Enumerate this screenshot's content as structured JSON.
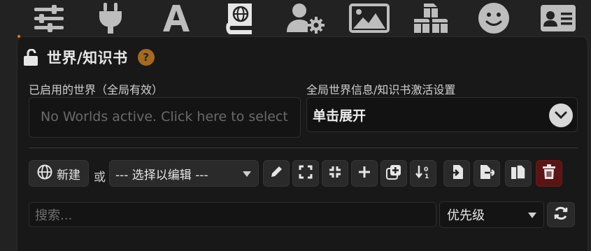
{
  "topbar": {
    "icons": [
      "sliders-icon",
      "plug-icon",
      "font-a-icon",
      "world-book-icon",
      "user-gear-icon",
      "image-landscape-icon",
      "cubes-icon",
      "smiley-icon",
      "id-card-icon"
    ],
    "active": "world-book-icon",
    "icon_color": "#bdbdbd"
  },
  "panel": {
    "title": "世界/知识书",
    "help_glyph": "?",
    "accent": "#a66a1e"
  },
  "active_worlds": {
    "label": "已启用的世界（全局有效）",
    "placeholder": "No Worlds active. Click here to select"
  },
  "global_settings": {
    "label": "全局世界信息/知识书激活设置",
    "expander_text": "单击展开"
  },
  "toolbar": {
    "new_label": "新建",
    "or_label": "或",
    "select_placeholder": "--- 选择以编辑 ---",
    "icons": [
      "pencil-icon",
      "expand-icon",
      "compress-icon",
      "plus-icon",
      "duplicate-plus-icon",
      "sort-numeric-icon",
      "file-import-icon",
      "file-export-icon",
      "copy-icon",
      "trash-icon"
    ],
    "danger_color": "#5a1414"
  },
  "filter": {
    "search_placeholder": "搜索...",
    "sort_value": "优先级"
  }
}
